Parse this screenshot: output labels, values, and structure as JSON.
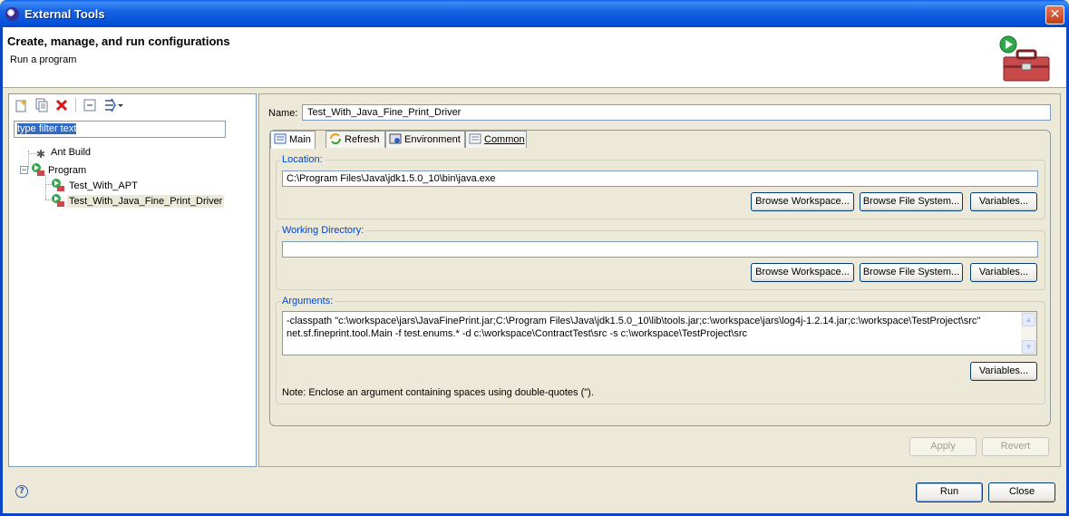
{
  "window": {
    "title": "External Tools",
    "close_label": "✕"
  },
  "header": {
    "title": "Create, manage, and run configurations",
    "subtitle": "Run a program"
  },
  "left": {
    "filter_placeholder": "type filter text",
    "tree": [
      {
        "label": "Ant Build"
      },
      {
        "label": "Program"
      },
      {
        "label": "Test_With_APT"
      },
      {
        "label": "Test_With_Java_Fine_Print_Driver"
      }
    ]
  },
  "form": {
    "name_label": "Name:",
    "name_value": "Test_With_Java_Fine_Print_Driver",
    "tabs": [
      {
        "label": "Main"
      },
      {
        "label": "Refresh"
      },
      {
        "label": "Environment"
      },
      {
        "label": "Common"
      }
    ],
    "location": {
      "label": "Location:",
      "value": "C:\\Program Files\\Java\\jdk1.5.0_10\\bin\\java.exe",
      "browse_workspace": "Browse Workspace...",
      "browse_fs": "Browse File System...",
      "variables": "Variables..."
    },
    "working_dir": {
      "label": "Working Directory:",
      "value": "",
      "browse_workspace": "Browse Workspace...",
      "browse_fs": "Browse File System...",
      "variables": "Variables..."
    },
    "arguments": {
      "label": "Arguments:",
      "line1": "-classpath \"c:\\workspace\\jars\\JavaFinePrint.jar;C:\\Program Files\\Java\\jdk1.5.0_10\\lib\\tools.jar;c:\\workspace\\jars\\log4j-1.2.14.jar;c:\\workspace\\TestProject\\src\"",
      "line2": "net.sf.fineprint.tool.Main -f test.enums.* -d c:\\workspace\\ContractTest\\src -s c:\\workspace\\TestProject\\src",
      "variables": "Variables...",
      "note": "Note: Enclose an argument containing spaces using double-quotes (\")."
    },
    "apply": "Apply",
    "revert": "Revert"
  },
  "footer": {
    "help": "?",
    "run": "Run",
    "close": "Close"
  }
}
